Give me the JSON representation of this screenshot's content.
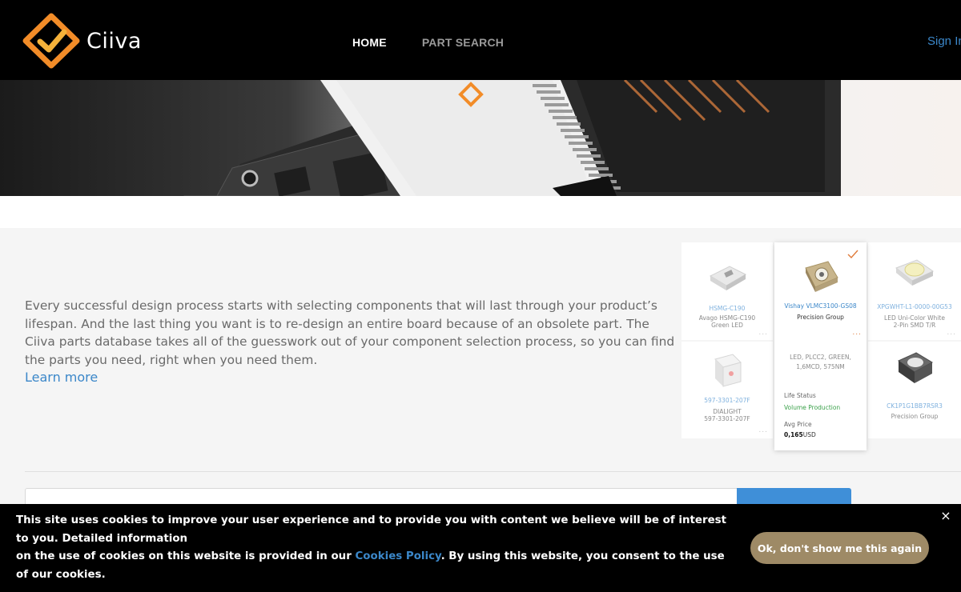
{
  "header": {
    "brand": "Ciiva",
    "nav": [
      {
        "label": "HOME",
        "active": true
      },
      {
        "label": "PART SEARCH",
        "active": false
      }
    ],
    "sign_in": "Sign In"
  },
  "info": {
    "paragraph": "Every successful design process starts with selecting components that will last through your product’s lifespan. And the last thing you want is to re-design an entire board because of an obsolete part. The Ciiva parts database takes all of the guesswork out of your component selection process, so you can find the parts you need, right when you need them.",
    "learn_more": "Learn more"
  },
  "parts": [
    {
      "part_number": "HSMG-C190",
      "desc1": "Avago HSMG-C190",
      "desc2": "Green LED"
    },
    {
      "part_number": "Vishay VLMC3100-GS08",
      "desc1": "Precision Group",
      "desc2": ""
    },
    {
      "part_number": "XPGWHT-L1-0000-00G53",
      "desc1": "LED Uni-Color White",
      "desc2": "2-Pin SMD T/R"
    },
    {
      "part_number": "597-3301-207F",
      "desc1": "DIALIGHT",
      "desc2": "597-3301-207F"
    },
    {
      "part_number": "CK1P1G1BB7RSR3",
      "desc1": "Precision Group",
      "desc2": ""
    }
  ],
  "featured_details": {
    "description_line1": "LED, PLCC2, GREEN,",
    "description_line2": "1,6MCD, 575NM",
    "life_status_label": "Life Status",
    "life_status_value": "Volume Production",
    "avg_price_label": "Avg Price",
    "avg_price_value": "0,165",
    "avg_price_currency": "USD"
  },
  "cookie": {
    "line1": "This site uses cookies to improve your user experience and to provide you with content we believe will be of interest to you. Detailed information",
    "line2_prefix": "on the use of cookies on this website is provided in our ",
    "policy_link": "Cookies Policy",
    "line2_suffix": ". By using this website, you consent to the use of our cookies.",
    "button": "Ok, don't show me this again",
    "close": "×"
  },
  "colors": {
    "accent_blue": "#3b87c9",
    "brand_orange": "#f28c28",
    "cookie_button": "#9e8a66",
    "status_green": "#3aa14a"
  }
}
